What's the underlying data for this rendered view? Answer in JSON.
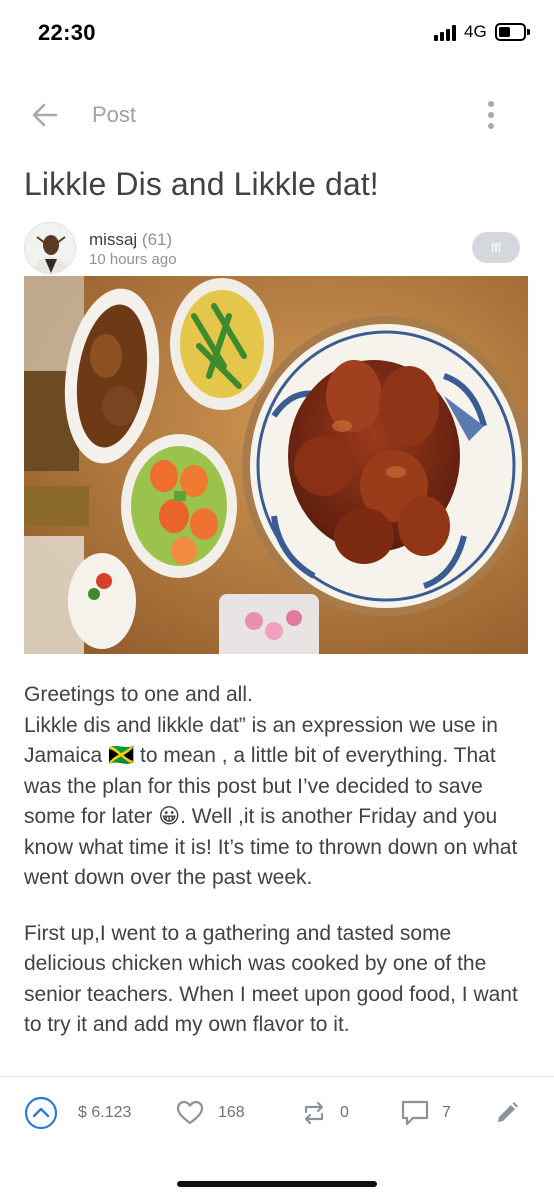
{
  "status_bar": {
    "time": "22:30",
    "network": "4G",
    "icons": [
      "signal-bars-icon",
      "battery-icon"
    ]
  },
  "header": {
    "title": "Post",
    "icons": [
      "back-arrow-icon",
      "more-vertical-icon"
    ]
  },
  "post": {
    "title": "Likkle Dis and Likkle dat!",
    "author": {
      "name": "missaj",
      "reputation": "(61)",
      "time_ago": "10 hours ago"
    },
    "tag": "fff",
    "paragraphs": [
      "Greetings to one and all.\nLikkle dis and likkle dat” is an expression we use in Jamaica 🇯🇲 to mean , a little bit of everything. That was the plan for this post but I’ve decided to save some for later 😀. Well ,it is another Friday and you know what time it is! It’s time to thrown down on what went down over the past week.",
      "First up,I went to a gathering and tasted some delicious chicken which was cooked by one of the senior teachers. When I meet upon good food, I want to try it and add my own flavor to it."
    ]
  },
  "actions": {
    "payout": "$ 6.123",
    "likes": "168",
    "reblogs": "0",
    "comments": "7",
    "icons": [
      "upvote-icon",
      "heart-icon",
      "reblog-icon",
      "comment-icon",
      "edit-icon"
    ]
  },
  "colors": {
    "accent_blue": "#2f79d6",
    "text_dark": "#3d4349",
    "text_muted": "#8b929a",
    "pill_gray": "#d4d7db"
  }
}
